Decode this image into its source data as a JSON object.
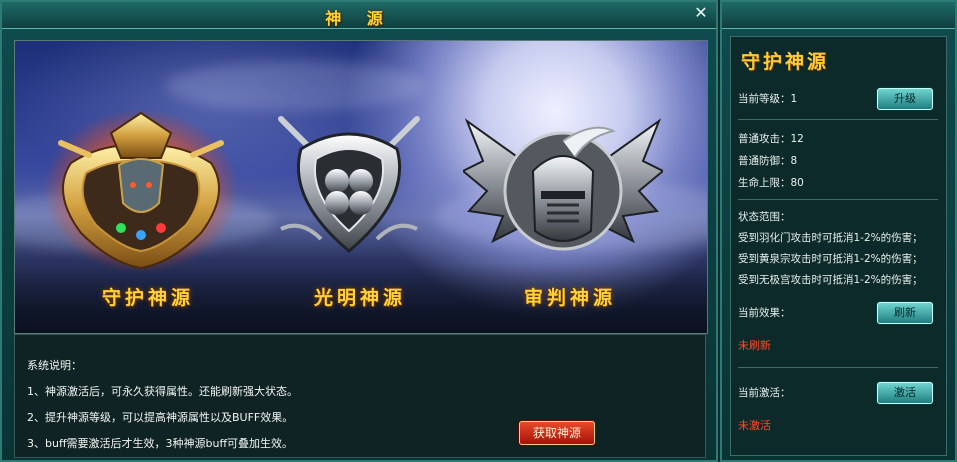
{
  "window": {
    "title": "神 源",
    "close_glyph": "✕"
  },
  "emblems": [
    {
      "name": "守护神源",
      "state": "selected",
      "glow_color": "#ff7a18",
      "metal": "gold"
    },
    {
      "name": "光明神源",
      "state": "normal",
      "metal": "silver"
    },
    {
      "name": "审判神源",
      "state": "normal",
      "metal": "silver"
    }
  ],
  "description": {
    "heading": "系统说明：",
    "lines": [
      "1、神源激活后，可永久获得属性。还能刷新强大状态。",
      "2、提升神源等级，可以提高神源属性以及BUFF效果。",
      "3、buff需要激活后才生效，3种神源buff可叠加生效。"
    ],
    "get_button": "获取神源"
  },
  "side": {
    "title": "守护神源",
    "level_label": "当前等级：",
    "level_value": "1",
    "upgrade_button": "升级",
    "stats": [
      {
        "label": "普通攻击：",
        "value": "12"
      },
      {
        "label": "普通防御：",
        "value": "8"
      },
      {
        "label": "生命上限：",
        "value": "80"
      }
    ],
    "status_heading": "状态范围：",
    "status_lines": [
      "受到羽化门攻击时可抵消1-2%的伤害；",
      "受到黄泉宗攻击时可抵消1-2%的伤害；",
      "受到无极宫攻击时可抵消1-2%的伤害；"
    ],
    "effect_label": "当前效果：",
    "refresh_button": "刷新",
    "effect_value": "未刷新",
    "activate_label": "当前激活：",
    "activate_button": "激活",
    "activate_value": "未激活"
  },
  "colors": {
    "frame": "#2d7b77",
    "title_gold": "#ffd43a",
    "alert_red": "#ff4a2a",
    "button_teal": "#1f7f80",
    "button_red": "#a41208"
  }
}
